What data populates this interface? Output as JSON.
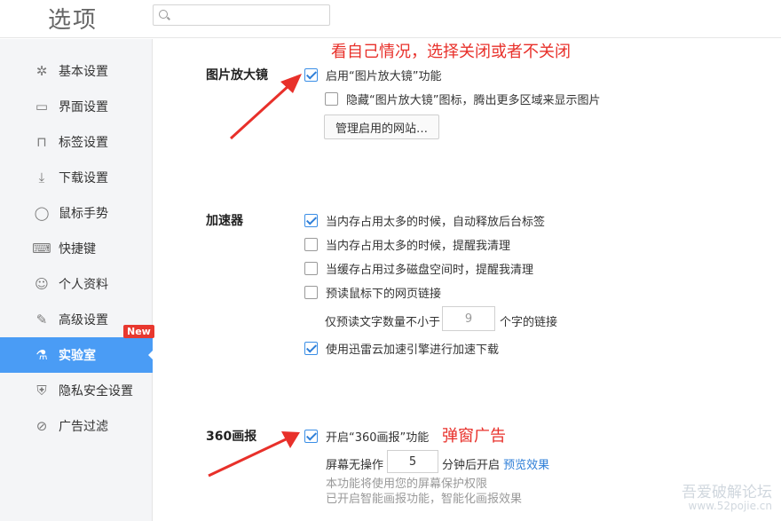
{
  "header": {
    "title": "选项"
  },
  "sidebar": {
    "items": [
      {
        "label": "基本设置",
        "icon": "gear-icon"
      },
      {
        "label": "界面设置",
        "icon": "window-icon"
      },
      {
        "label": "标签设置",
        "icon": "tab-icon"
      },
      {
        "label": "下载设置",
        "icon": "download-icon"
      },
      {
        "label": "鼠标手势",
        "icon": "mouse-icon"
      },
      {
        "label": "快捷键",
        "icon": "keyboard-icon"
      },
      {
        "label": "个人资料",
        "icon": "person-icon"
      },
      {
        "label": "高级设置",
        "icon": "wrench-icon"
      },
      {
        "label": "实验室",
        "icon": "flask-icon",
        "active": true
      },
      {
        "label": "隐私安全设置",
        "icon": "shield-icon"
      },
      {
        "label": "广告过滤",
        "icon": "block-icon"
      }
    ],
    "new_badge": "New",
    "active_color": "#4a9cf5"
  },
  "main": {
    "magnifier": {
      "title": "图片放大镜",
      "enable_label": "启用“图片放大镜”功能",
      "enable_checked": true,
      "hide_label": "隐藏“图片放大镜”图标，腾出更多区域来显示图片",
      "hide_checked": false,
      "manage_button": "管理启用的网站…"
    },
    "accelerator": {
      "title": "加速器",
      "opt1": "当内存占用太多的时候，自动释放后台标签",
      "opt2": "当内存占用太多的时候，提醒我清理",
      "opt3": "当缓存占用过多磁盘空间时，提醒我清理",
      "opt4": "预读鼠标下的网页链接",
      "min_chars_prefix": "仅预读文字数量不小于",
      "min_chars_value": "9",
      "min_chars_suffix": "个字的链接",
      "opt5": "使用迅雷云加速引擎进行加速下载",
      "checked": [
        true,
        false,
        false,
        false,
        true
      ]
    },
    "picture360": {
      "title": "360画报",
      "enable_label": "开启“360画报”功能",
      "enable_checked": true,
      "idle_prefix": "屏幕无操作",
      "idle_value": "5",
      "idle_suffix": "分钟后开启",
      "preview_link": "预览效果",
      "note1": "本功能将使用您的屏幕保护权限",
      "note2": "已开启智能画报功能，智能化画报效果"
    }
  },
  "annotations": {
    "magnifier_note": "看自己情况，选择关闭或者不关闭",
    "popup_note": "弹窗广告",
    "color": "#e8302a"
  },
  "watermark": {
    "line1": "吾爱破解论坛",
    "line2": "www.52pojie.cn"
  }
}
